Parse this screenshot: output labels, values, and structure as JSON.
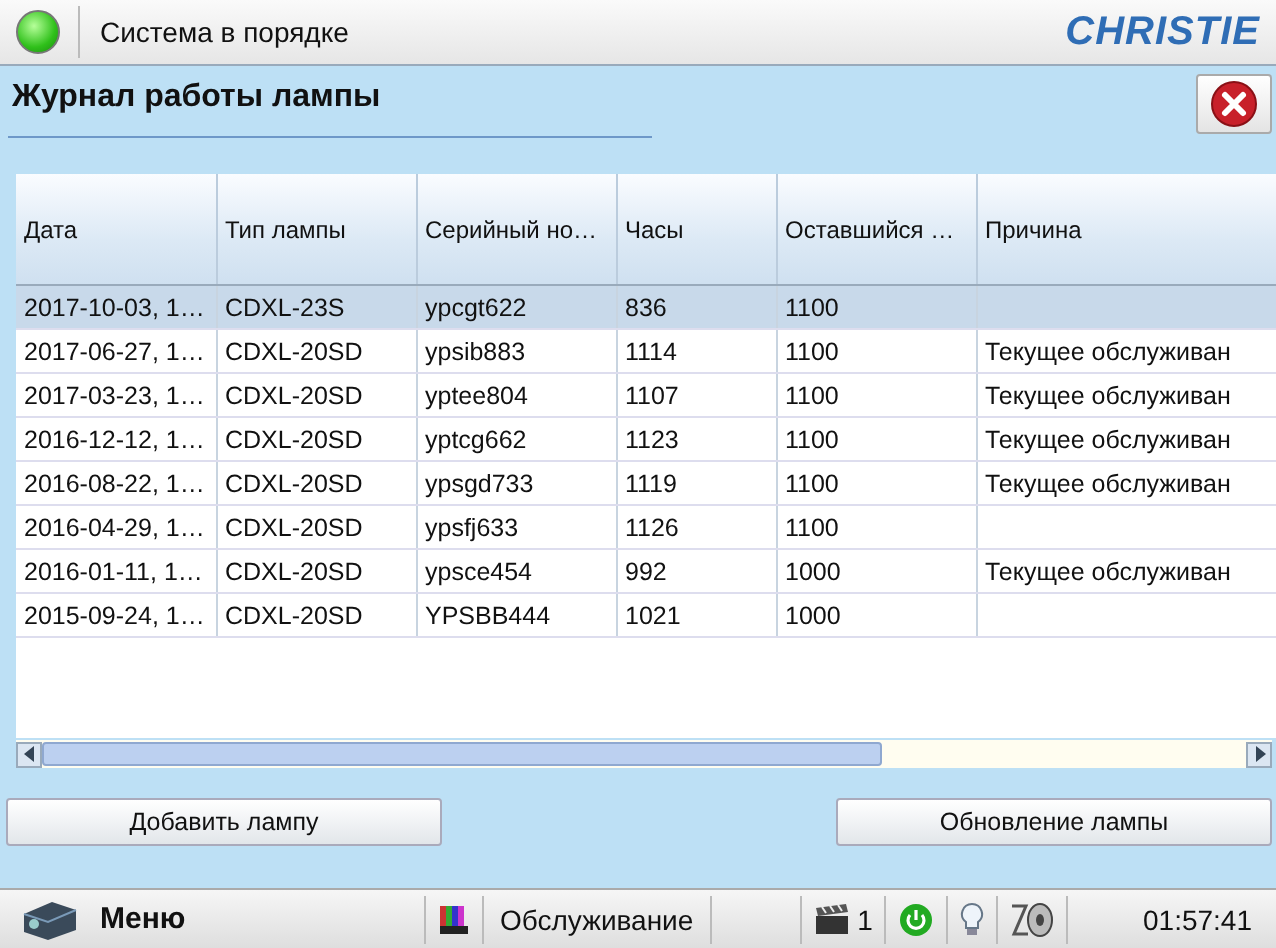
{
  "status": {
    "text": "Система в порядке",
    "ok": true
  },
  "logo": "CHRISTIE",
  "panel": {
    "title": "Журнал работы лампы"
  },
  "table": {
    "columns": [
      "Дата",
      "Тип лампы",
      "Серийный но…",
      "Часы",
      "Оставшийся …",
      "Причина"
    ],
    "rows": [
      {
        "cells": [
          "2017-10-03, 1…",
          "CDXL-23S",
          "ypcgt622",
          "836",
          "1100",
          ""
        ],
        "selected": true
      },
      {
        "cells": [
          "2017-06-27, 1…",
          "CDXL-20SD",
          "ypsib883",
          "1114",
          "1100",
          "Текущее обслуживан"
        ],
        "selected": false
      },
      {
        "cells": [
          "2017-03-23, 1…",
          "CDXL-20SD",
          "yptee804",
          "1107",
          "1100",
          "Текущее обслуживан"
        ],
        "selected": false
      },
      {
        "cells": [
          "2016-12-12, 1…",
          "CDXL-20SD",
          "yptcg662",
          "1123",
          "1100",
          "Текущее обслуживан"
        ],
        "selected": false
      },
      {
        "cells": [
          "2016-08-22, 1…",
          "CDXL-20SD",
          "ypsgd733",
          "1119",
          "1100",
          "Текущее обслуживан"
        ],
        "selected": false
      },
      {
        "cells": [
          "2016-04-29, 1…",
          "CDXL-20SD",
          "ypsfj633",
          "1126",
          "1100",
          ""
        ],
        "selected": false
      },
      {
        "cells": [
          "2016-01-11, 1…",
          "CDXL-20SD",
          "ypsce454",
          "992",
          "1000",
          "Текущее обслуживан"
        ],
        "selected": false
      },
      {
        "cells": [
          "2015-09-24, 1…",
          "CDXL-20SD",
          "YPSBB444",
          "1021",
          "1000",
          ""
        ],
        "selected": false
      }
    ]
  },
  "buttons": [
    "Добавить лампу",
    "Обновление лампы"
  ],
  "taskbar": {
    "menu": "Меню",
    "mode": "Обслуживание",
    "channel": "1",
    "time": "01:57:41"
  }
}
